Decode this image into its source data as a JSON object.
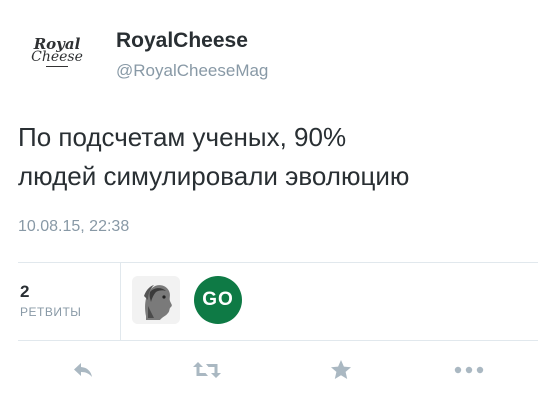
{
  "tweet": {
    "author": {
      "display_name": "RoyalCheese",
      "handle": "@RoyalCheeseMag",
      "avatar_line1": "Royal",
      "avatar_line2": "Cheese"
    },
    "text_line1": "По подсчетам ученых, 90%",
    "text_line2": "людей симулировали эволюцию",
    "timestamp": "10.08.15, 22:38",
    "stats": {
      "retweet_count": "2",
      "retweet_label": "РЕТВИТЫ"
    },
    "retweeters": [
      {
        "name": "retweeter-avatar-1",
        "icon": "sculpture-portrait"
      },
      {
        "name": "retweeter-avatar-2",
        "text": "GO",
        "color": "#0e7a45"
      }
    ],
    "actions": [
      {
        "name": "reply",
        "icon": "reply-icon"
      },
      {
        "name": "retweet",
        "icon": "retweet-icon"
      },
      {
        "name": "favorite",
        "icon": "star-icon"
      },
      {
        "name": "more",
        "icon": "more-dots-icon"
      }
    ]
  },
  "colors": {
    "text": "#292f33",
    "muted": "#8899a6",
    "divider": "#e1e8ed",
    "icon": "#aab8c2",
    "go_badge": "#0e7a45"
  }
}
